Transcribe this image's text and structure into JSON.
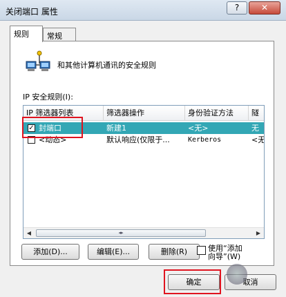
{
  "window": {
    "title": "关闭端口 属性",
    "help_label": "?",
    "close_label": "✕"
  },
  "tabs": [
    {
      "label": "规则",
      "active": true
    },
    {
      "label": "常规",
      "active": false
    }
  ],
  "description": "和其他计算机通讯的安全规则",
  "rules_label": "IP 安全规则(I):",
  "columns": [
    "IP 筛选器列表",
    "筛选器操作",
    "身份验证方法",
    "隧"
  ],
  "rows": [
    {
      "checked": true,
      "filter_list": "封端口",
      "filter_action": "新建1",
      "auth": "<无>",
      "tunnel": "无",
      "selected": true
    },
    {
      "checked": false,
      "filter_list": "<动态>",
      "filter_action": "默认响应(仅限于...",
      "auth": "Kerberos",
      "tunnel": "<无",
      "selected": false
    }
  ],
  "scroll_thumb_glyph": "◂▸",
  "buttons": {
    "add": "添加(D)...",
    "edit": "编辑(E)...",
    "delete": "删除(R)",
    "wizard": "使用“添加向导”(W)"
  },
  "dialog": {
    "ok": "确定",
    "cancel": "取消"
  },
  "colors": {
    "selection": "#33a7b5",
    "highlight": "#e0131f"
  }
}
